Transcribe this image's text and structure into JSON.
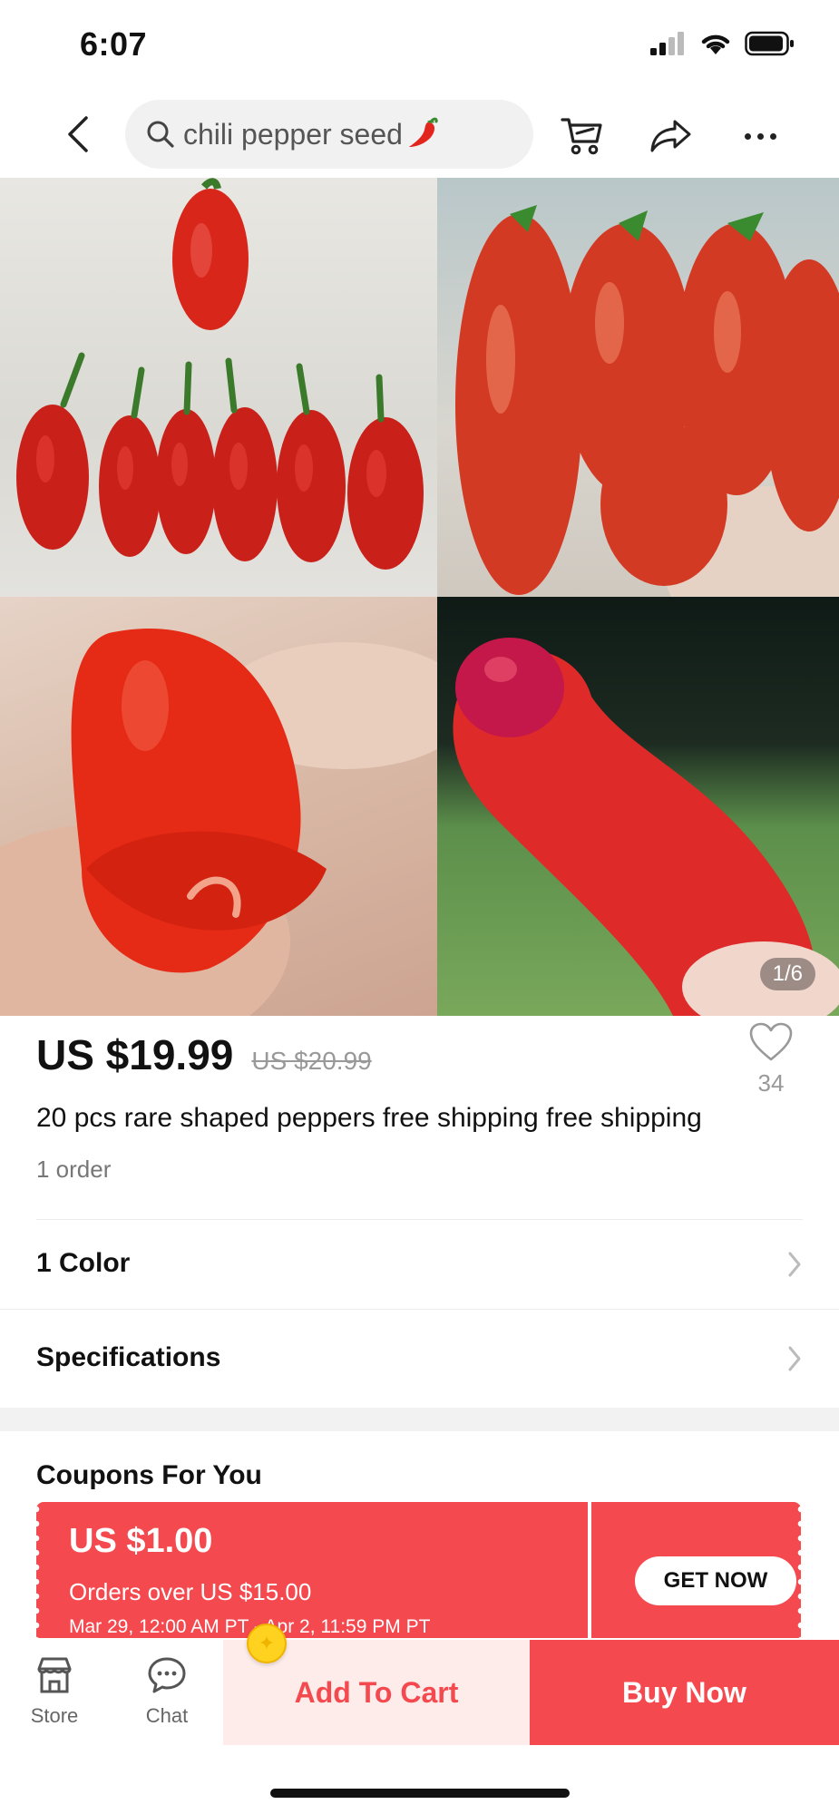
{
  "status_bar": {
    "time": "6:07"
  },
  "header": {
    "search_text": "chili pepper seed",
    "icons": {
      "back": "back-chevron-icon",
      "cart": "shopping-cart-icon",
      "share": "share-icon",
      "more": "more-horizontal-icon"
    }
  },
  "gallery": {
    "page_indicator": "1/6"
  },
  "product": {
    "price": "US $19.99",
    "original_price": "US $20.99",
    "wishlist_count": "34",
    "title": "20 pcs rare shaped peppers free shipping free shipping",
    "orders": "1 order"
  },
  "options": [
    {
      "label": "1 Color"
    },
    {
      "label": "Specifications"
    }
  ],
  "coupons": {
    "title": "Coupons For You",
    "items": [
      {
        "amount": "US $1.00",
        "condition": "Orders over US $15.00",
        "dates": "Mar 29, 12:00 AM PT - Apr 2, 11:59 PM PT",
        "cta": "GET NOW"
      }
    ]
  },
  "bottom_bar": {
    "store_label": "Store",
    "chat_label": "Chat",
    "add_to_cart": "Add To Cart",
    "buy_now": "Buy Now"
  },
  "colors": {
    "accent": "#f44a4f",
    "add_to_cart_bg": "#fdecea"
  }
}
